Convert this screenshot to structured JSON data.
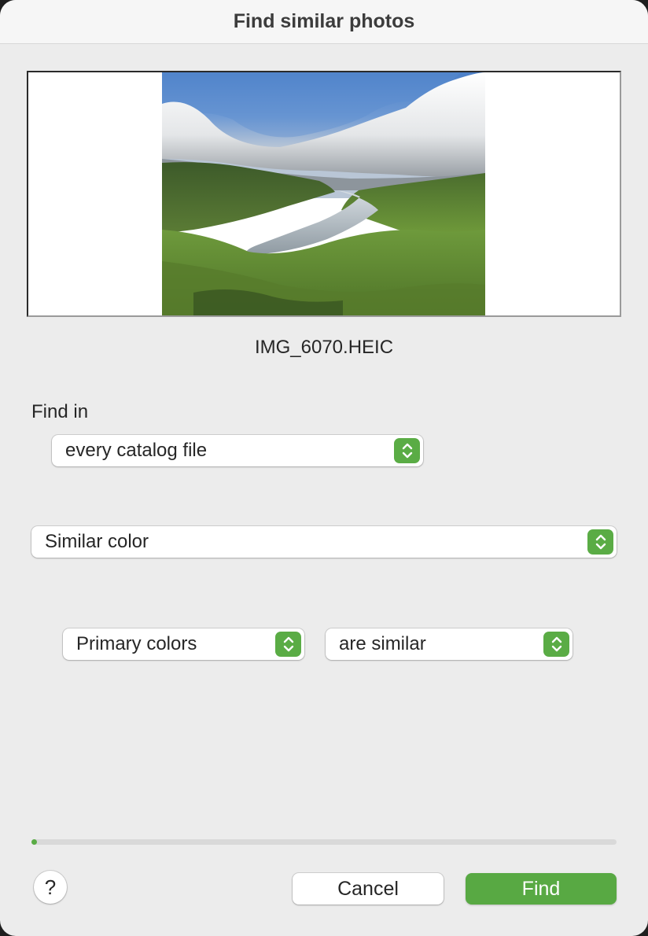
{
  "window": {
    "title": "Find similar photos"
  },
  "preview": {
    "filename": "IMG_6070.HEIC"
  },
  "find_in": {
    "label": "Find in",
    "selected": "every catalog file"
  },
  "criteria": {
    "selected": "Similar color"
  },
  "condition": {
    "attribute": "Primary colors",
    "operator": "are similar"
  },
  "progress": {
    "fraction": 0.005
  },
  "buttons": {
    "help": "?",
    "cancel": "Cancel",
    "find": "Find"
  },
  "colors": {
    "accent": "#5aac45",
    "window_bg": "#ececec"
  }
}
